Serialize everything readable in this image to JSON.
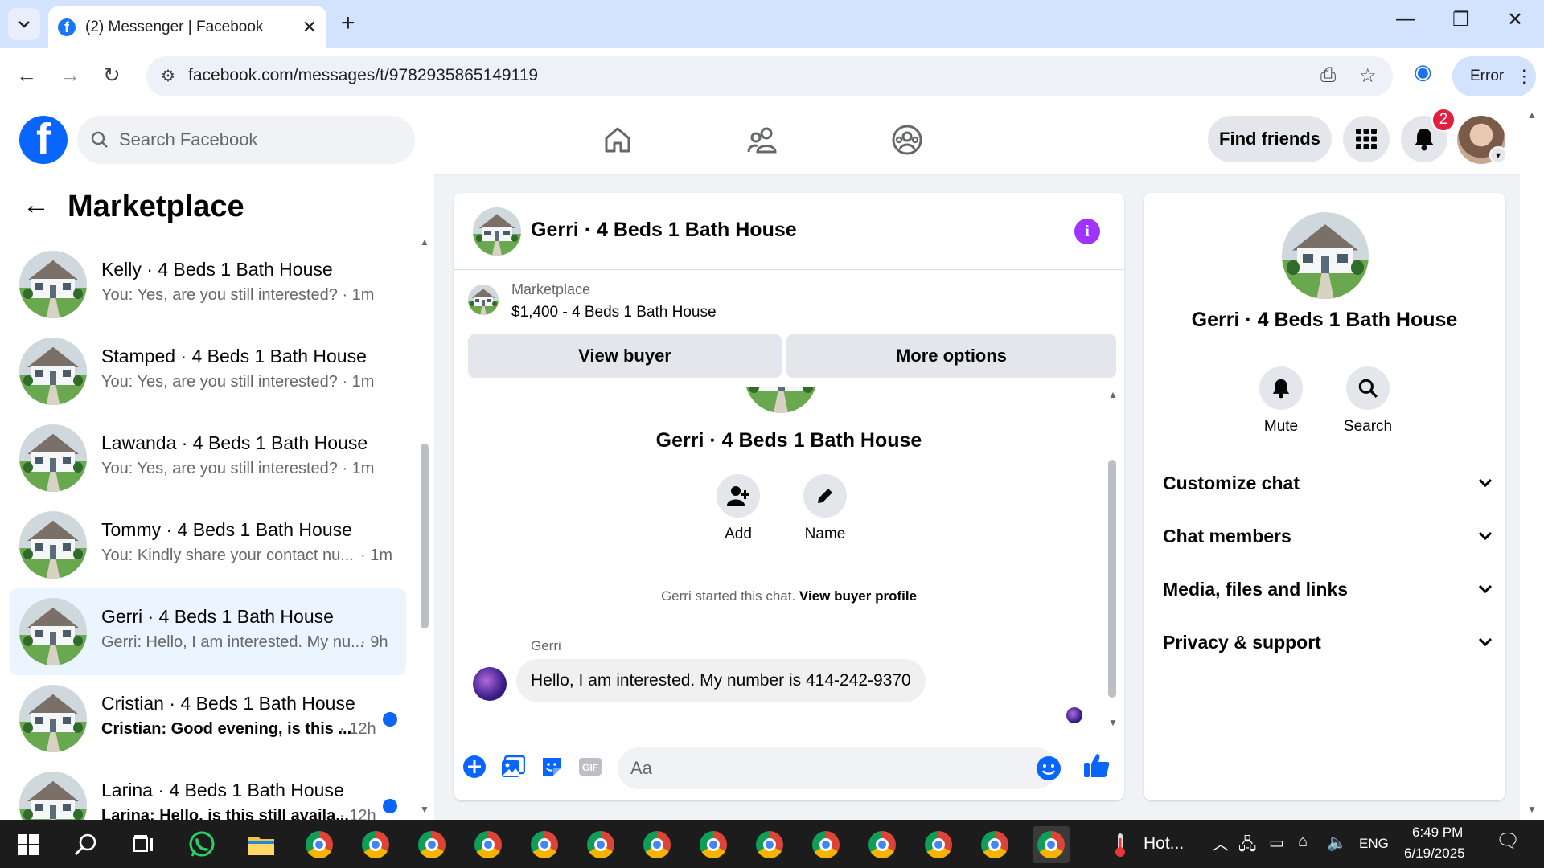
{
  "browser": {
    "tab_title": "(2) Messenger | Facebook",
    "url": "facebook.com/messages/t/9782935865149119",
    "profile_status": "Error"
  },
  "header": {
    "search_placeholder": "Search Facebook",
    "find_friends": "Find friends",
    "notification_count": "2"
  },
  "left": {
    "title": "Marketplace",
    "conversations": [
      {
        "name": "Kelly · 4 Beds 1 Bath House",
        "snippet": "You: Yes, are you still interested? · 1m",
        "time": "",
        "unread": false,
        "active": false
      },
      {
        "name": "Stamped · 4 Beds 1 Bath House",
        "snippet": "You: Yes, are you still interested? · 1m",
        "time": "",
        "unread": false,
        "active": false
      },
      {
        "name": "Lawanda · 4 Beds 1 Bath House",
        "snippet": "You: Yes, are you still interested? · 1m",
        "time": "",
        "unread": false,
        "active": false
      },
      {
        "name": "Tommy · 4 Beds 1 Bath House",
        "snippet": "You: Kindly share your contact nu...",
        "time": "· 1m",
        "unread": false,
        "active": false
      },
      {
        "name": "Gerri · 4 Beds 1 Bath House",
        "snippet": "Gerri: Hello, I am interested. My nu...",
        "time": "· 9h",
        "unread": false,
        "active": true
      },
      {
        "name": "Cristian · 4 Beds 1 Bath House",
        "snippet": "Cristian: Good evening, is this ...",
        "time": "· 12h",
        "unread": true,
        "active": false
      },
      {
        "name": "Larina · 4 Beds 1 Bath House",
        "snippet": "Larina: Hello, is this still availa...",
        "time": "· 12h",
        "unread": true,
        "active": false
      }
    ]
  },
  "chat": {
    "title": "Gerri · 4 Beds 1 Bath House",
    "marketplace_label": "Marketplace",
    "listing": "$1,400 - 4 Beds 1 Bath House",
    "view_buyer": "View buyer",
    "more_options": "More options",
    "intro_name": "Gerri · 4 Beds 1 Bath House",
    "add_label": "Add",
    "name_label": "Name",
    "started_text": "Gerri started this chat.",
    "view_buyer_profile": "View buyer profile",
    "sender": "Gerri",
    "message": "Hello, I am interested. My number is 414-242-9370",
    "composer_placeholder": "Aa"
  },
  "details": {
    "name": "Gerri · 4 Beds 1 Bath House",
    "mute": "Mute",
    "search": "Search",
    "sections": [
      "Customize chat",
      "Chat members",
      "Media, files and links",
      "Privacy & support"
    ]
  },
  "taskbar": {
    "weather": "Hot...",
    "lang": "ENG",
    "time": "6:49 PM",
    "date": "6/19/2025"
  },
  "colors": {
    "fb_blue": "#0866ff",
    "active_conv": "#ebf5ff",
    "info_purple": "#a033ff",
    "badge_red": "#e41e3f"
  }
}
